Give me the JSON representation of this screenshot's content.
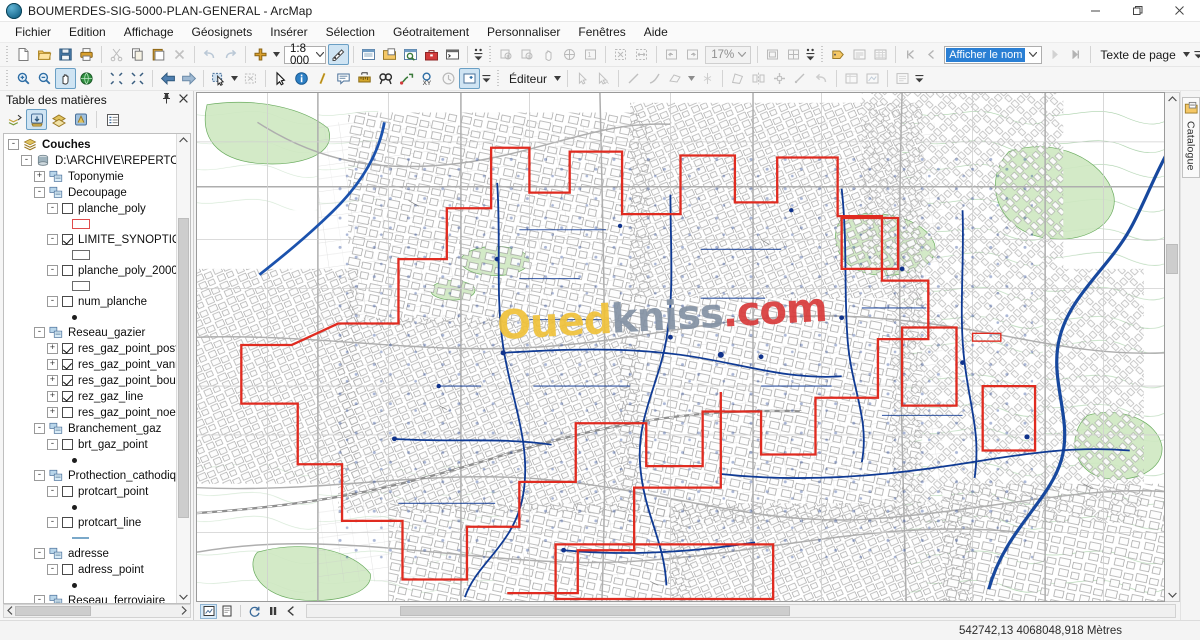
{
  "window": {
    "title": "BOUMERDES-SIG-5000-PLAN-GENERAL - ArcMap",
    "app_icon": "arcmap-globe-icon",
    "minimize_label": "—",
    "maximize_label": "❐",
    "close_label": "✕"
  },
  "menubar": {
    "items": [
      {
        "label": "Fichier",
        "name": "menu-fichier"
      },
      {
        "label": "Edition",
        "name": "menu-edition"
      },
      {
        "label": "Affichage",
        "name": "menu-affichage"
      },
      {
        "label": "Géosignets",
        "name": "menu-geosignets"
      },
      {
        "label": "Insérer",
        "name": "menu-inserer"
      },
      {
        "label": "Sélection",
        "name": "menu-selection"
      },
      {
        "label": "Géotraitement",
        "name": "menu-geotraitement"
      },
      {
        "label": "Personnaliser",
        "name": "menu-personnaliser"
      },
      {
        "label": "Fenêtres",
        "name": "menu-fenetres"
      },
      {
        "label": "Aide",
        "name": "menu-aide"
      }
    ]
  },
  "toolbar_standard": {
    "scale_value": "1:8 000",
    "zoom_value": "17%",
    "page_text_label": "Texte de page",
    "name_field_value": "Afficher le nom",
    "buttons": [
      "new-document-icon",
      "open-folder-icon",
      "save-icon",
      "print-icon",
      "cut-icon",
      "copy-icon",
      "paste-icon",
      "delete-icon",
      "undo-icon",
      "redo-icon",
      "add-data-icon"
    ]
  },
  "toolbar_tools": {
    "editor_label": "Éditeur",
    "buttons": [
      "zoom-in-icon",
      "zoom-out-icon",
      "pan-icon",
      "full-extent-icon",
      "fixed-zoom-in-icon",
      "fixed-zoom-out-icon",
      "go-back-extent-icon",
      "go-next-extent-icon",
      "select-features-icon",
      "clear-selection-icon",
      "select-elements-icon",
      "identify-icon",
      "hyperlink-icon",
      "html-popup-icon",
      "measure-icon",
      "find-icon",
      "find-route-icon",
      "go-to-xy-icon",
      "time-slider-icon",
      "create-viewer-icon"
    ]
  },
  "toc": {
    "title": "Table des matières",
    "pin_icon": "pin-icon",
    "close_icon": "close-icon",
    "toolbar_buttons": [
      "list-by-drawing-order-icon",
      "list-by-source-icon",
      "list-by-visibility-icon",
      "list-by-selection-icon",
      "options-icon"
    ],
    "tree": [
      {
        "indent": 0,
        "expander": "-",
        "icon": "layers-icon",
        "label": "Couches",
        "check": null,
        "bold": true
      },
      {
        "indent": 1,
        "expander": "-",
        "icon": "database-icon",
        "label": "D:\\ARCHIVE\\REPERTOIRE",
        "check": null,
        "bold": false
      },
      {
        "indent": 2,
        "expander": "+",
        "icon": "dataset-icon",
        "label": "Toponymie",
        "check": null,
        "bold": false
      },
      {
        "indent": 2,
        "expander": "-",
        "icon": "dataset-icon",
        "label": "Decoupage",
        "check": null,
        "bold": false
      },
      {
        "indent": 3,
        "expander": "-",
        "icon": null,
        "label": "planche_poly",
        "check": false,
        "bold": false,
        "symbol": "rect-red"
      },
      {
        "indent": 3,
        "expander": "-",
        "icon": null,
        "label": "LIMITE_SYNOPTIQ",
        "check": true,
        "bold": false,
        "symbol": "rect-black"
      },
      {
        "indent": 3,
        "expander": "-",
        "icon": null,
        "label": "planche_poly_2000",
        "check": false,
        "bold": false,
        "symbol": "rect-black"
      },
      {
        "indent": 3,
        "expander": "-",
        "icon": null,
        "label": "num_planche",
        "check": false,
        "bold": false,
        "symbol": "dot-black"
      },
      {
        "indent": 2,
        "expander": "-",
        "icon": "dataset-icon",
        "label": "Reseau_gazier",
        "check": null,
        "bold": false
      },
      {
        "indent": 3,
        "expander": "+",
        "icon": null,
        "label": "res_gaz_point_post",
        "check": true,
        "bold": false
      },
      {
        "indent": 3,
        "expander": "+",
        "icon": null,
        "label": "res_gaz_point_vanr",
        "check": true,
        "bold": false
      },
      {
        "indent": 3,
        "expander": "+",
        "icon": null,
        "label": "res_gaz_point_bou",
        "check": true,
        "bold": false
      },
      {
        "indent": 3,
        "expander": "+",
        "icon": null,
        "label": "rez_gaz_line",
        "check": true,
        "bold": false
      },
      {
        "indent": 3,
        "expander": "+",
        "icon": null,
        "label": "res_gaz_point_noe",
        "check": false,
        "bold": false
      },
      {
        "indent": 2,
        "expander": "-",
        "icon": "dataset-icon",
        "label": "Branchement_gaz",
        "check": null,
        "bold": false
      },
      {
        "indent": 3,
        "expander": "-",
        "icon": null,
        "label": "brt_gaz_point",
        "check": false,
        "bold": false,
        "symbol": "dot-black"
      },
      {
        "indent": 2,
        "expander": "-",
        "icon": "dataset-icon",
        "label": "Prothection_cathodiqu",
        "check": null,
        "bold": false
      },
      {
        "indent": 3,
        "expander": "-",
        "icon": null,
        "label": "protcart_point",
        "check": false,
        "bold": false,
        "symbol": "dot-black"
      },
      {
        "indent": 3,
        "expander": "-",
        "icon": null,
        "label": "protcart_line",
        "check": false,
        "bold": false,
        "symbol": "line-blue"
      },
      {
        "indent": 2,
        "expander": "-",
        "icon": "dataset-icon",
        "label": "adresse",
        "check": null,
        "bold": false
      },
      {
        "indent": 3,
        "expander": "-",
        "icon": null,
        "label": "adress_point",
        "check": false,
        "bold": false,
        "symbol": "dot-black"
      },
      {
        "indent": 2,
        "expander": "-",
        "icon": "dataset-icon",
        "label": "Reseau_ferroviaire",
        "check": null,
        "bold": false
      }
    ]
  },
  "map": {
    "watermark": {
      "part1": "Oued",
      "part2": "kniss",
      "part3": ".com"
    },
    "bottom_buttons": [
      "data-view-icon",
      "layout-view-icon",
      "refresh-icon",
      "pause-drawing-icon",
      "toggle-draw-icon"
    ]
  },
  "sidetabs": {
    "catalogue": {
      "label": "Catalogue",
      "icon": "catalog-icon"
    }
  },
  "statusbar": {
    "coordinates": "542742,13  4068048,918 Mètres"
  },
  "colors": {
    "accent_blue": "#2a7fd4",
    "boundary_red": "#e02b20",
    "gas_line_blue": "#1248a8",
    "green_area": "#3ea33e",
    "building_gray": "#8a8a8a"
  }
}
